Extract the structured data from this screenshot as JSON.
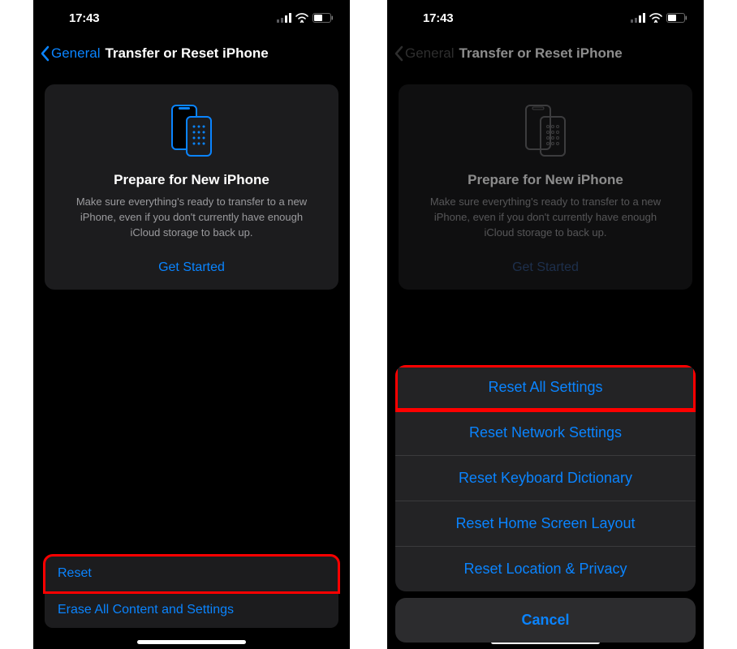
{
  "status": {
    "time": "17:43"
  },
  "nav": {
    "back_label": "General",
    "title": "Transfer or Reset iPhone"
  },
  "prepare_card": {
    "title": "Prepare for New iPhone",
    "description": "Make sure everything's ready to transfer to a new iPhone, even if you don't currently have enough iCloud storage to back up.",
    "action": "Get Started"
  },
  "bottom": {
    "reset": "Reset",
    "erase": "Erase All Content and Settings"
  },
  "sheet": {
    "items": [
      "Reset All Settings",
      "Reset Network Settings",
      "Reset Keyboard Dictionary",
      "Reset Home Screen Layout",
      "Reset Location & Privacy"
    ],
    "cancel": "Cancel"
  }
}
